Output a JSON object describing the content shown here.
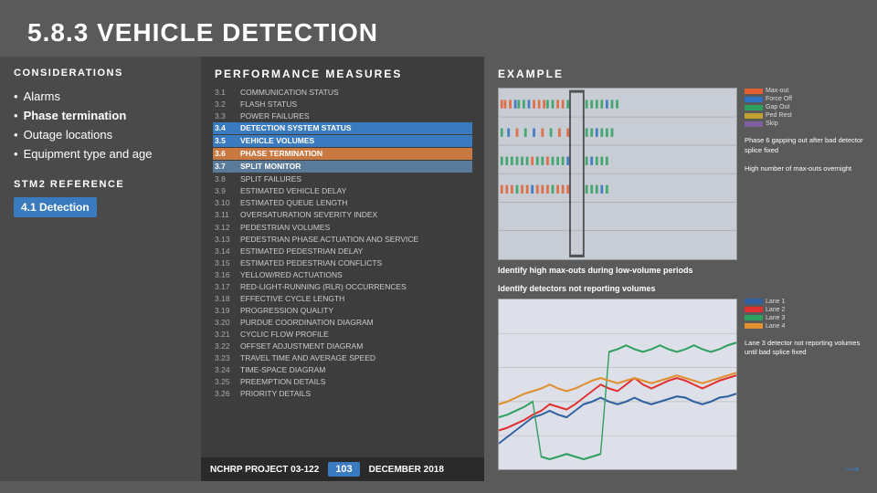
{
  "title": "5.8.3 VEHICLE DETECTION",
  "left": {
    "header": "CONSIDERATIONS",
    "items": [
      {
        "text": "Alarms",
        "bold": false
      },
      {
        "text": "Phase termination",
        "bold": true
      },
      {
        "text": "Outage locations",
        "bold": false
      },
      {
        "text": "Equipment type and age",
        "bold": false
      }
    ],
    "stm_header": "STM2 REFERENCE",
    "stm_link": "4.1 Detection"
  },
  "middle": {
    "header": "PERFORMANCE MEASURES",
    "items": [
      {
        "num": "3.1",
        "text": "COMMUNICATION STATUS",
        "style": "normal"
      },
      {
        "num": "3.2",
        "text": "FLASH STATUS",
        "style": "normal"
      },
      {
        "num": "3.3",
        "text": "POWER FAILURES",
        "style": "normal"
      },
      {
        "num": "3.4",
        "text": "DETECTION SYSTEM STATUS",
        "style": "blue"
      },
      {
        "num": "3.5",
        "text": "VEHICLE VOLUMES",
        "style": "blue"
      },
      {
        "num": "3.6",
        "text": "PHASE TERMINATION",
        "style": "orange"
      },
      {
        "num": "3.7",
        "text": "SPLIT MONITOR",
        "style": "light"
      },
      {
        "num": "3.8",
        "text": "SPLIT FAILURES",
        "style": "normal"
      },
      {
        "num": "3.9",
        "text": "ESTIMATED VEHICLE DELAY",
        "style": "normal"
      },
      {
        "num": "3.10",
        "text": "ESTIMATED QUEUE LENGTH",
        "style": "normal"
      },
      {
        "num": "3.11",
        "text": "OVERSATURATION SEVERITY INDEX",
        "style": "normal"
      },
      {
        "num": "3.12",
        "text": "PEDESTRIAN VOLUMES",
        "style": "normal"
      },
      {
        "num": "3.13",
        "text": "PEDESTRIAN PHASE ACTUATION AND SERVICE",
        "style": "normal"
      },
      {
        "num": "3.14",
        "text": "ESTIMATED PEDESTRIAN DELAY",
        "style": "normal"
      },
      {
        "num": "3.15",
        "text": "ESTIMATED PEDESTRIAN CONFLICTS",
        "style": "normal"
      },
      {
        "num": "3.16",
        "text": "YELLOW/RED ACTUATIONS",
        "style": "normal"
      },
      {
        "num": "3.17",
        "text": "RED-LIGHT-RUNNING (RLR) OCCURRENCES",
        "style": "normal"
      },
      {
        "num": "3.18",
        "text": "EFFECTIVE CYCLE LENGTH",
        "style": "normal"
      },
      {
        "num": "3.19",
        "text": "PROGRESSION QUALITY",
        "style": "normal"
      },
      {
        "num": "3.20",
        "text": "PURDUE COORDINATION DIAGRAM",
        "style": "normal"
      },
      {
        "num": "3.21",
        "text": "CYCLIC FLOW PROFILE",
        "style": "normal"
      },
      {
        "num": "3.22",
        "text": "OFFSET ADJUSTMENT DIAGRAM",
        "style": "normal"
      },
      {
        "num": "3.23",
        "text": "TRAVEL TIME AND AVERAGE SPEED",
        "style": "normal"
      },
      {
        "num": "3.24",
        "text": "TIME-SPACE DIAGRAM",
        "style": "normal"
      },
      {
        "num": "3.25",
        "text": "PREEMPTION DETAILS",
        "style": "normal"
      },
      {
        "num": "3.26",
        "text": "PRIORITY DETAILS",
        "style": "normal"
      }
    ],
    "nchrp": "NCHRP PROJECT 03-122",
    "page": "103",
    "date": "DECEMBER 2018"
  },
  "right": {
    "header": "EXAMPLE",
    "top_desc": "Identify high max-outs during low-volume periods",
    "top_annotation": "Phase 6 gapping out after bad detector splice fixed",
    "top_annotation2": "High number of max-outs overnight",
    "legend": [
      {
        "color": "#e06030",
        "label": "Max-out"
      },
      {
        "color": "#3070c0",
        "label": "Force Off"
      },
      {
        "color": "#30a060",
        "label": "Gap Out"
      },
      {
        "color": "#c0a030",
        "label": "Ped Rest"
      },
      {
        "color": "#8060a0",
        "label": "Skip"
      }
    ],
    "bottom_desc": "Identify detectors not reporting volumes",
    "bottom_annotation": "Lane 3 detector not reporting volumes until bad splice fixed",
    "legend2": [
      {
        "color": "#3060a0",
        "label": "Lane 1"
      },
      {
        "color": "#e03030",
        "label": "Lane 2"
      },
      {
        "color": "#30a060",
        "label": "Lane 3"
      },
      {
        "color": "#e09030",
        "label": "Lane 4"
      }
    ]
  }
}
